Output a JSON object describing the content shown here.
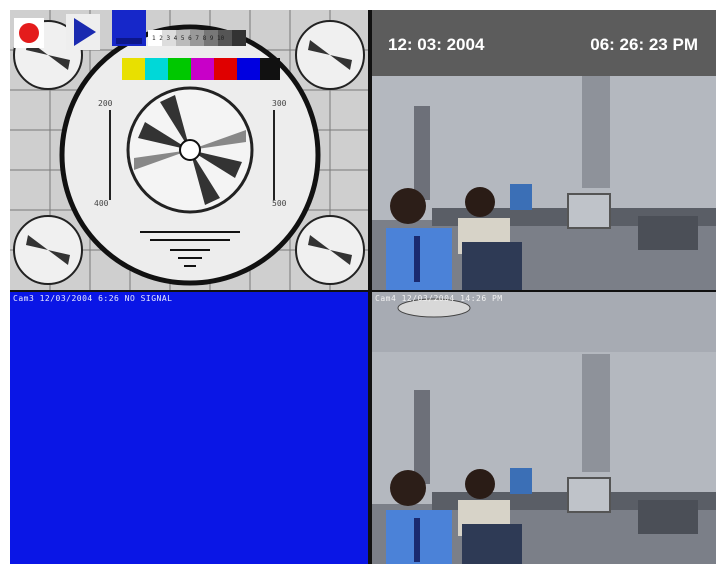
{
  "recording_info": {
    "date": "12: 03: 2004",
    "time": "06: 26: 23 PM"
  },
  "cameras": [
    {
      "id": "cam-1",
      "label": "",
      "content": "test-pattern"
    },
    {
      "id": "cam-2",
      "label": "",
      "content": "office-scene"
    },
    {
      "id": "cam-3",
      "label": "Cam3  12/03/2004  6:26  NO SIGNAL",
      "content": "no-signal"
    },
    {
      "id": "cam-4",
      "label": "Cam4  12/03/2004  14:26  PM",
      "content": "office-scene"
    }
  ],
  "controls": {
    "record_icon": "record-icon",
    "play_icon": "play-icon",
    "stop_icon": "stop-icon"
  },
  "colors": {
    "no_signal_blue": "#0a16e6",
    "record_red": "#e41c1c",
    "overlay_gray": "#5c5c5c"
  },
  "test_pattern": {
    "scale_digits": "1 2 3 4 5 6 7 8 9 10",
    "line_labels": [
      "200",
      "300",
      "400",
      "500"
    ]
  }
}
